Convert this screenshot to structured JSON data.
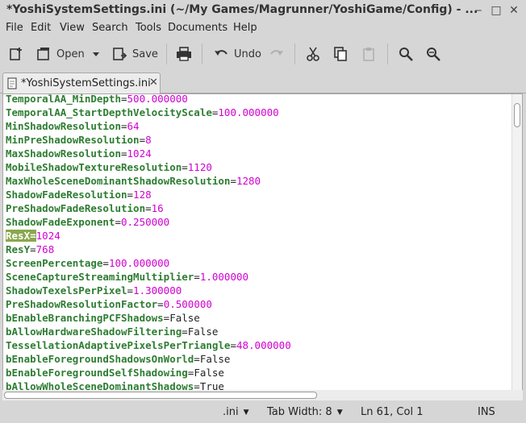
{
  "window": {
    "title": "*YoshiSystemSettings.ini (~/My Games/Magrunner/YoshiGame/Config) - ...",
    "minimize_glyph": "‒",
    "maximize_glyph": "□",
    "close_glyph": "✕"
  },
  "menu": {
    "items": [
      {
        "label": "File"
      },
      {
        "label": "Edit"
      },
      {
        "label": "View"
      },
      {
        "label": "Search"
      },
      {
        "label": "Tools"
      },
      {
        "label": "Documents"
      },
      {
        "label": "Help"
      }
    ]
  },
  "toolbar": {
    "open_label": "Open",
    "save_label": "Save",
    "undo_label": "Undo"
  },
  "tab": {
    "label": "*YoshiSystemSettings.ini",
    "close_glyph": "✕"
  },
  "editor": {
    "lines": [
      {
        "key": "TemporalAA_MinDepth",
        "value": "500.000000",
        "colored": true
      },
      {
        "key": "TemporalAA_StartDepthVelocityScale",
        "value": "100.000000",
        "colored": true
      },
      {
        "key": "MinShadowResolution",
        "value": "64",
        "colored": true
      },
      {
        "key": "MinPreShadowResolution",
        "value": "8",
        "colored": true
      },
      {
        "key": "MaxShadowResolution",
        "value": "1024",
        "colored": true
      },
      {
        "key": "MobileShadowTextureResolution",
        "value": "1120",
        "colored": true
      },
      {
        "key": "MaxWholeSceneDominantShadowResolution",
        "value": "1280",
        "colored": true
      },
      {
        "key": "ShadowFadeResolution",
        "value": "128",
        "colored": true
      },
      {
        "key": "PreShadowFadeResolution",
        "value": "16",
        "colored": true
      },
      {
        "key": "ShadowFadeExponent",
        "value": "0.250000",
        "colored": true
      },
      {
        "key": "ResX",
        "value": "1024",
        "colored": true,
        "selected": true
      },
      {
        "key": "ResY",
        "value": "768",
        "colored": true
      },
      {
        "key": "ScreenPercentage",
        "value": "100.000000",
        "colored": true
      },
      {
        "key": "SceneCaptureStreamingMultiplier",
        "value": "1.000000",
        "colored": true
      },
      {
        "key": "ShadowTexelsPerPixel",
        "value": "1.300000",
        "colored": true
      },
      {
        "key": "PreShadowResolutionFactor",
        "value": "0.500000",
        "colored": true
      },
      {
        "key": "bEnableBranchingPCFShadows",
        "value": "False",
        "colored": false
      },
      {
        "key": "bAllowHardwareShadowFiltering",
        "value": "False",
        "colored": false
      },
      {
        "key": "TessellationAdaptivePixelsPerTriangle",
        "value": "48.000000",
        "colored": true
      },
      {
        "key": "bEnableForegroundShadowsOnWorld",
        "value": "False",
        "colored": false
      },
      {
        "key": "bEnableForegroundSelfShadowing",
        "value": "False",
        "colored": false
      },
      {
        "key": "bAllowWholeSceneDominantShadows",
        "value": "True",
        "colored": false
      }
    ],
    "key_color": "#2e7d32",
    "value_color": "#d000d0",
    "selection_color": "#8aa74e"
  },
  "statusbar": {
    "language": ".ini",
    "tab_width": "Tab Width:  8",
    "position": "Ln 61, Col 1",
    "mode": "INS"
  },
  "icons": {
    "new": "new-document-icon",
    "open": "open-folder-icon",
    "save": "save-icon",
    "print": "print-icon",
    "undo": "undo-icon",
    "redo": "redo-icon",
    "cut": "cut-icon",
    "copy": "copy-icon",
    "paste": "paste-icon",
    "find": "find-icon",
    "replace": "find-replace-icon"
  }
}
